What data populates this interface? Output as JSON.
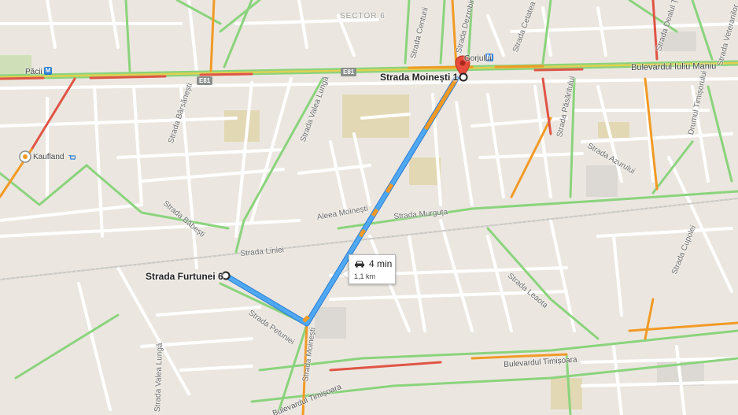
{
  "route": {
    "origin_label": "Strada Furtunei 6",
    "destination_label": "Strada Moinești 1",
    "duration": "4 min",
    "distance": "1,1 km",
    "mode_icon": "car-icon",
    "route_color": "#4fa9f2",
    "traffic_slow_color": "#f29a25",
    "marker_color": "#e84c3d"
  },
  "shields": {
    "e81_left": "E81",
    "e81_right": "E81"
  },
  "metro": {
    "paci": "M",
    "gorjului": "M"
  },
  "places": {
    "kaufland": "Kaufland"
  },
  "labels": {
    "sector": "SECTOR 6",
    "paci": "Păcii",
    "gorjului": "Gorjului",
    "iuliu_maniu": "Bulevardul Iuliu Maniu",
    "timisoara_1": "Bulevardul Timișoara",
    "timisoara_2": "Bulevardul Timișoara",
    "barsanesti": "Strada Bârsănești",
    "valea_lunga": "Strada Valea Lungă",
    "valea_lunga_2": "Strada Valea Lungă",
    "babesti": "Strada Băbești",
    "liniei": "Strada Liniei",
    "petuniei": "Strada Petuniei",
    "moinesti_street": "Strada Moinești",
    "aleea_moinesti": "Aleea Moinești",
    "murguta": "Strada Murguța",
    "leaota": "Strada Leaota",
    "pasaritului": "Strada Păsăritului",
    "azurului": "Strada Azurului",
    "timisorului": "Drumul Timișorului",
    "cupolei": "Strada Cupolei",
    "cetatea": "Strada Cetatea de Baltă",
    "dezrobirii": "Strada Dezrobirii",
    "centurii": "Strada Centurii",
    "dealul_tugui": "Strada Dealul Țugui",
    "veteranilor": "Strada Veteranilor"
  }
}
